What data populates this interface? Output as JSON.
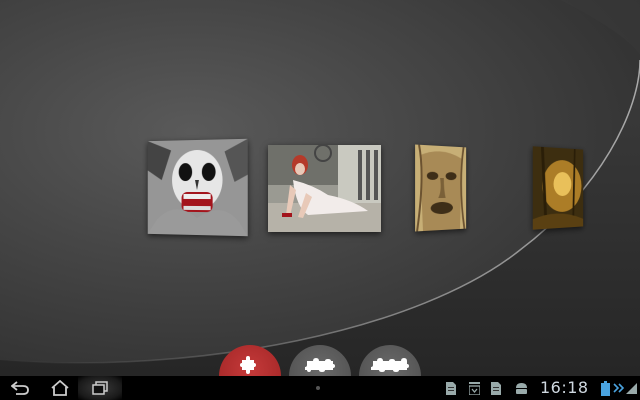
{
  "carousel": {
    "cards": [
      {
        "name": "zombie-face-card",
        "icon": "zombie-face-image"
      },
      {
        "name": "bride-crawling-card",
        "icon": "ghost-bride-image"
      },
      {
        "name": "tree-face-card",
        "icon": "tree-face-image"
      },
      {
        "name": "golden-forest-card",
        "icon": "golden-forest-image"
      }
    ]
  },
  "modes": [
    {
      "icon": "puzzle-piece-icon",
      "color": "#b22e2e",
      "selected": true
    },
    {
      "icon": "puzzle-medium-icon",
      "color": "#5a5a5a",
      "selected": false
    },
    {
      "icon": "puzzle-large-icon",
      "color": "#5a5a5a",
      "selected": false
    }
  ],
  "navbar": {
    "back_icon": "back-icon",
    "home_icon": "home-icon",
    "recent_icon": "recent-apps-icon"
  },
  "status": {
    "clock": "16:18",
    "icons": [
      "document-icon",
      "download-icon",
      "document-icon",
      "android-icon",
      "battery-icon",
      "signal-icon"
    ]
  }
}
